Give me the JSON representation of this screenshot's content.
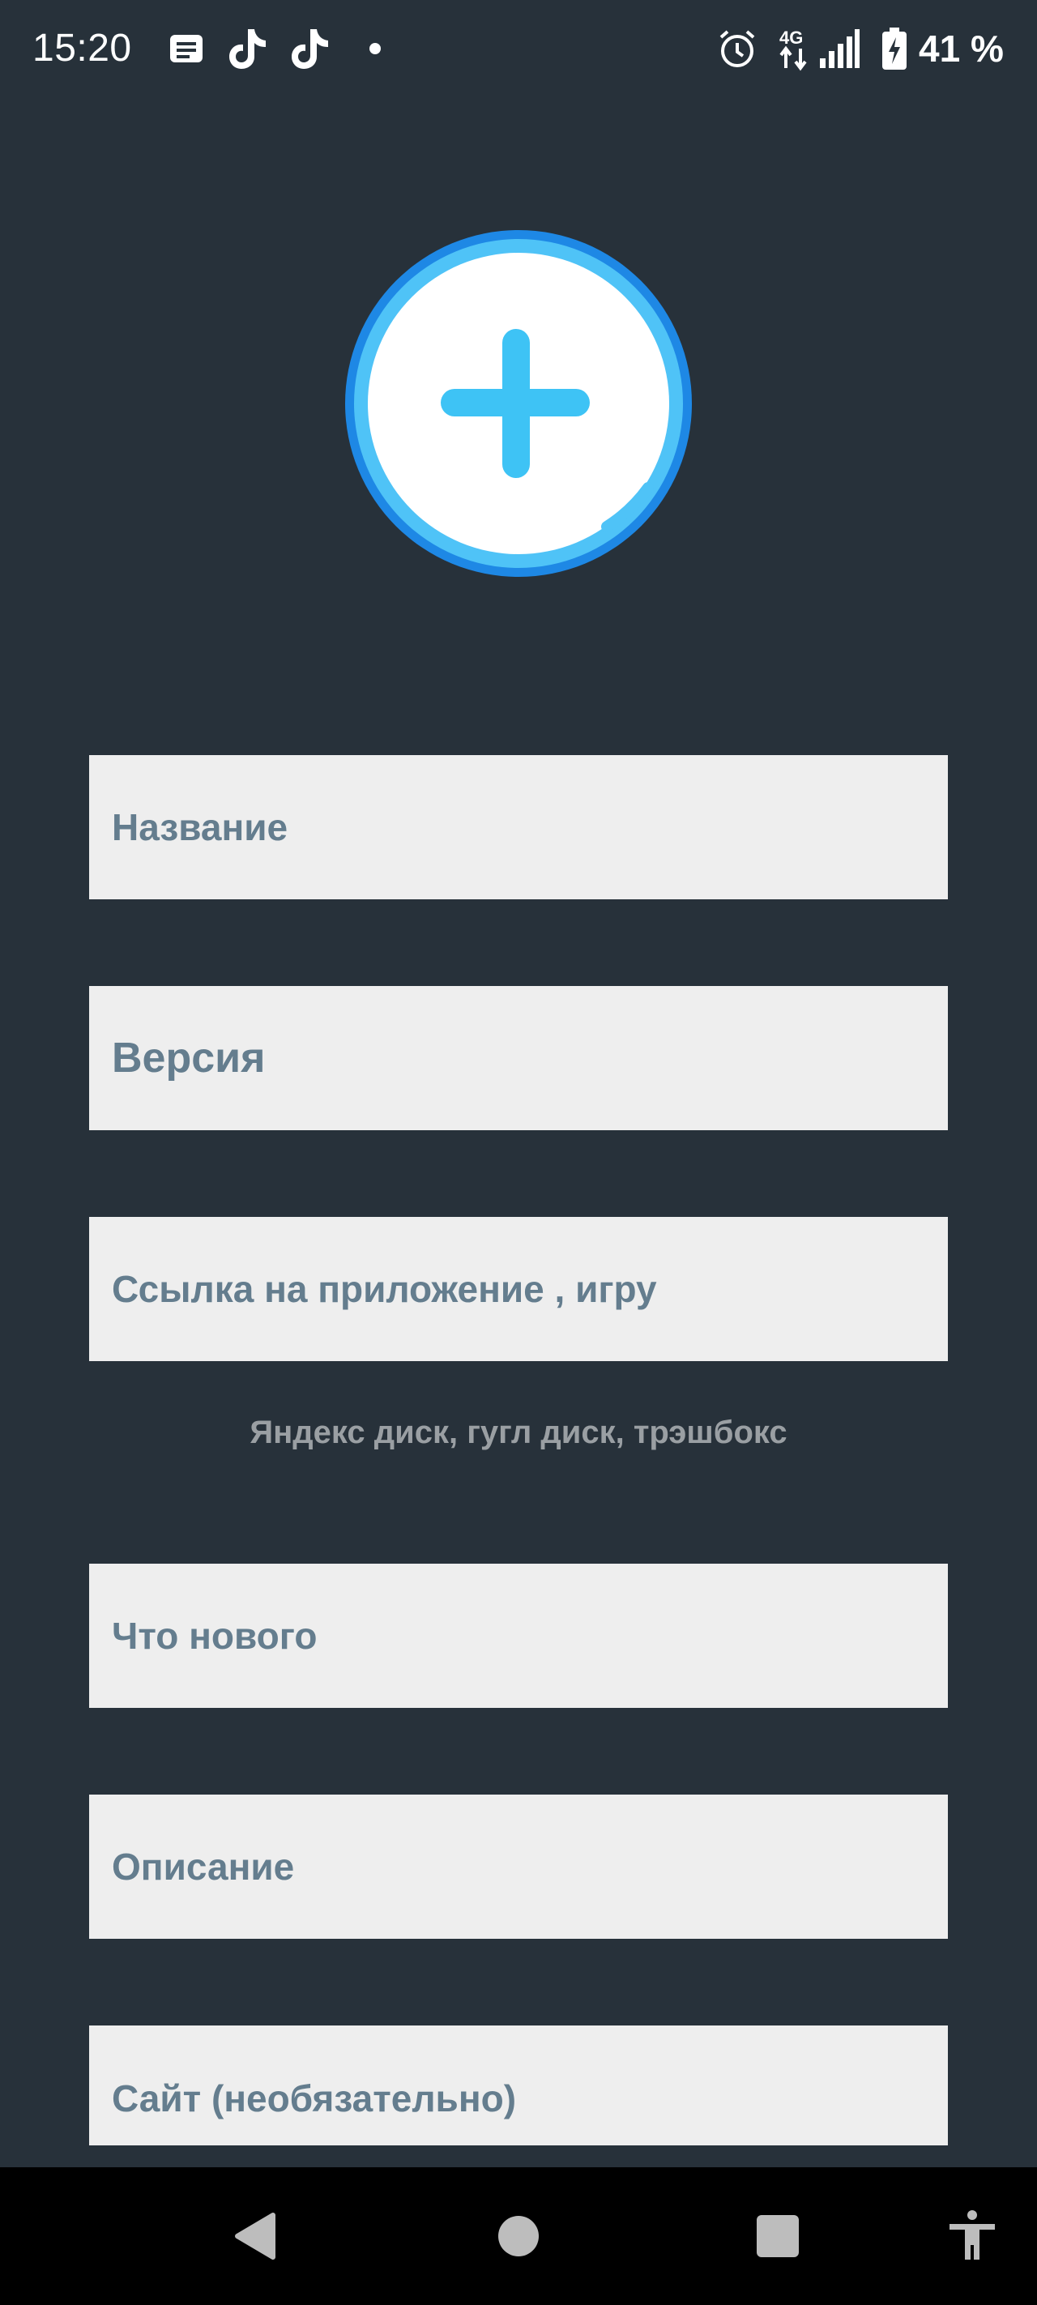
{
  "status_bar": {
    "time": "15:20",
    "network": "4G",
    "battery": "41 %",
    "icons": [
      "message-icon",
      "tiktok-icon",
      "tiktok-icon",
      "dot-icon",
      "alarm-icon",
      "network-4g-icon",
      "signal-icon",
      "battery-charging-icon"
    ]
  },
  "avatar": {
    "icon": "plus-icon",
    "colors": {
      "ring": "#1e88e5",
      "ring_light": "#4fc3f7",
      "plus": "#3ec3f5"
    }
  },
  "form": {
    "name_placeholder": "Название",
    "version_placeholder": "Версия",
    "link_placeholder": "Ссылка на приложение , игру",
    "link_hint": "Яндекс диск, гугл диск, трэшбокс",
    "whats_new_placeholder": "Что нового",
    "description_placeholder": "Описание",
    "site_placeholder": "Сайт (необязательно)"
  },
  "nav": {
    "back": "back-icon",
    "home": "home-icon",
    "recents": "recents-icon",
    "accessibility": "accessibility-icon"
  },
  "colors": {
    "background": "#27313a",
    "field": "#eeeeee",
    "field_text": "#647d8e",
    "hint_text": "#9a9fa3"
  }
}
